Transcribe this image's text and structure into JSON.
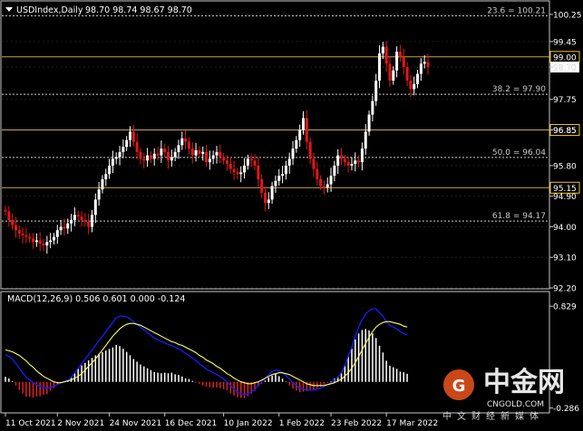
{
  "header": {
    "symbol": "USDIndex,Daily",
    "ohlc": "98.70 98.74 98.67 98.70"
  },
  "macd_header": "MACD(12,26,9) 0.506 0.601 0.000 -0.124",
  "watermark": {
    "brand": "中金网",
    "site": "CNGOLD.COM",
    "tagline": "中文财经新媒体"
  },
  "colors": {
    "background": "#000000",
    "grid": "#1e1e1e",
    "bull": "#ffffff",
    "bear": "#e01818",
    "level": "#c8a15a",
    "macd_hist_pos": "#ffffff",
    "macd_hist_neg": "#e02020",
    "macd_line": "#1a1aff",
    "signal_line": "#ffff66"
  },
  "chart_data": [
    {
      "type": "candlestick",
      "title": "USDIndex,Daily",
      "price_axis_ticks": [
        "100.25",
        "99.45",
        "98.70",
        "97.75",
        "96.85",
        "95.80",
        "94.90",
        "94.00",
        "93.10",
        "92.20"
      ],
      "ylim": [
        92.2,
        100.3
      ],
      "date_axis_ticks": [
        "11 Oct 2021",
        "2 Nov 2021",
        "24 Nov 2021",
        "16 Dec 2021",
        "10 Jan 2022",
        "1 Feb 2022",
        "23 Feb 2022",
        "17 Mar 2022"
      ],
      "fib_levels": [
        {
          "label": "23.6 = 100.21",
          "value": 100.21
        },
        {
          "label": "38.2 = 97.90",
          "value": 97.9
        },
        {
          "label": "50.0 = 96.04",
          "value": 96.04
        },
        {
          "label": "61.8 = 94.17",
          "value": 94.17
        }
      ],
      "key_levels": [
        {
          "label": "99.00",
          "value": 99.0
        },
        {
          "label": "96.85",
          "value": 96.85
        },
        {
          "label": "95.15",
          "value": 95.15
        }
      ],
      "current_price": {
        "label": "98.70",
        "value": 98.7
      },
      "closes": [
        94.45,
        94.2,
        94.05,
        93.9,
        93.8,
        93.75,
        93.7,
        93.65,
        93.55,
        93.6,
        93.5,
        93.45,
        93.55,
        93.6,
        93.7,
        93.9,
        94.0,
        93.95,
        94.1,
        94.2,
        94.35,
        94.3,
        94.2,
        94.15,
        94.0,
        94.35,
        94.8,
        95.1,
        95.4,
        95.55,
        95.8,
        96.0,
        96.05,
        96.2,
        96.35,
        96.55,
        96.8,
        96.5,
        96.2,
        96.0,
        95.95,
        96.1,
        96.0,
        96.15,
        96.1,
        96.3,
        96.2,
        95.95,
        96.05,
        96.2,
        96.4,
        96.6,
        96.5,
        96.3,
        96.1,
        96.25,
        96.15,
        96.2,
        95.9,
        96.0,
        96.1,
        96.2,
        96.05,
        95.95,
        95.85,
        95.7,
        95.6,
        95.55,
        95.6,
        95.8,
        96.0,
        95.95,
        95.8,
        95.4,
        95.0,
        94.7,
        94.8,
        95.2,
        95.35,
        95.5,
        95.55,
        95.8,
        96.0,
        96.3,
        96.55,
        96.85,
        97.2,
        96.5,
        96.0,
        95.7,
        95.4,
        95.2,
        95.15,
        95.25,
        95.5,
        95.8,
        96.1,
        96.0,
        95.9,
        95.8,
        95.85,
        95.95,
        95.9,
        96.3,
        96.8,
        97.3,
        97.7,
        98.3,
        99.1,
        99.3,
        98.8,
        98.3,
        98.6,
        99.15,
        99.0,
        98.7,
        98.3,
        98.05,
        98.2,
        98.5,
        98.8,
        98.85,
        98.7
      ],
      "macd_axis_ticks": [
        "0.829",
        "-0.286"
      ],
      "macd_ylim": [
        -0.3,
        0.85
      ],
      "macd_line": [
        0.3,
        0.28,
        0.25,
        0.2,
        0.15,
        0.1,
        0.05,
        0.02,
        -0.01,
        -0.03,
        -0.05,
        -0.06,
        -0.07,
        -0.06,
        -0.05,
        -0.03,
        -0.01,
        0.0,
        0.02,
        0.05,
        0.1,
        0.15,
        0.2,
        0.25,
        0.3,
        0.35,
        0.4,
        0.45,
        0.5,
        0.55,
        0.6,
        0.65,
        0.7,
        0.72,
        0.72,
        0.71,
        0.69,
        0.66,
        0.63,
        0.6,
        0.57,
        0.54,
        0.51,
        0.48,
        0.46,
        0.44,
        0.43,
        0.41,
        0.4,
        0.38,
        0.36,
        0.34,
        0.31,
        0.29,
        0.26,
        0.23,
        0.2,
        0.17,
        0.14,
        0.12,
        0.1,
        0.08,
        0.06,
        0.03,
        0.0,
        -0.04,
        -0.08,
        -0.11,
        -0.13,
        -0.14,
        -0.13,
        -0.11,
        -0.08,
        -0.04,
        0.0,
        0.04,
        0.08,
        0.11,
        0.13,
        0.12,
        0.1,
        0.07,
        0.03,
        -0.01,
        -0.04,
        -0.07,
        -0.08,
        -0.09,
        -0.09,
        -0.09,
        -0.08,
        -0.07,
        -0.05,
        -0.03,
        -0.01,
        0.02,
        0.05,
        0.1,
        0.18,
        0.28,
        0.38,
        0.5,
        0.6,
        0.68,
        0.74,
        0.78,
        0.8,
        0.8,
        0.76,
        0.72,
        0.66,
        0.62,
        0.6,
        0.58,
        0.55,
        0.53,
        0.51
      ],
      "signal_line": [
        0.35,
        0.34,
        0.33,
        0.31,
        0.29,
        0.26,
        0.23,
        0.19,
        0.16,
        0.12,
        0.09,
        0.06,
        0.04,
        0.02,
        0.0,
        -0.01,
        -0.01,
        0.0,
        0.01,
        0.02,
        0.04,
        0.06,
        0.09,
        0.13,
        0.17,
        0.21,
        0.25,
        0.3,
        0.35,
        0.4,
        0.45,
        0.5,
        0.54,
        0.58,
        0.61,
        0.63,
        0.64,
        0.64,
        0.63,
        0.62,
        0.6,
        0.58,
        0.56,
        0.54,
        0.52,
        0.5,
        0.48,
        0.46,
        0.44,
        0.43,
        0.41,
        0.4,
        0.38,
        0.36,
        0.34,
        0.32,
        0.29,
        0.27,
        0.24,
        0.22,
        0.2,
        0.17,
        0.15,
        0.12,
        0.09,
        0.07,
        0.04,
        0.02,
        0.0,
        -0.01,
        -0.02,
        -0.02,
        -0.01,
        0.0,
        0.02,
        0.04,
        0.06,
        0.08,
        0.09,
        0.1,
        0.1,
        0.09,
        0.08,
        0.06,
        0.04,
        0.02,
        0.0,
        -0.02,
        -0.03,
        -0.04,
        -0.04,
        -0.04,
        -0.04,
        -0.03,
        -0.02,
        -0.01,
        0.01,
        0.03,
        0.06,
        0.1,
        0.15,
        0.21,
        0.28,
        0.35,
        0.42,
        0.49,
        0.55,
        0.6,
        0.63,
        0.65,
        0.66,
        0.66,
        0.65,
        0.64,
        0.63,
        0.61,
        0.6
      ]
    }
  ]
}
